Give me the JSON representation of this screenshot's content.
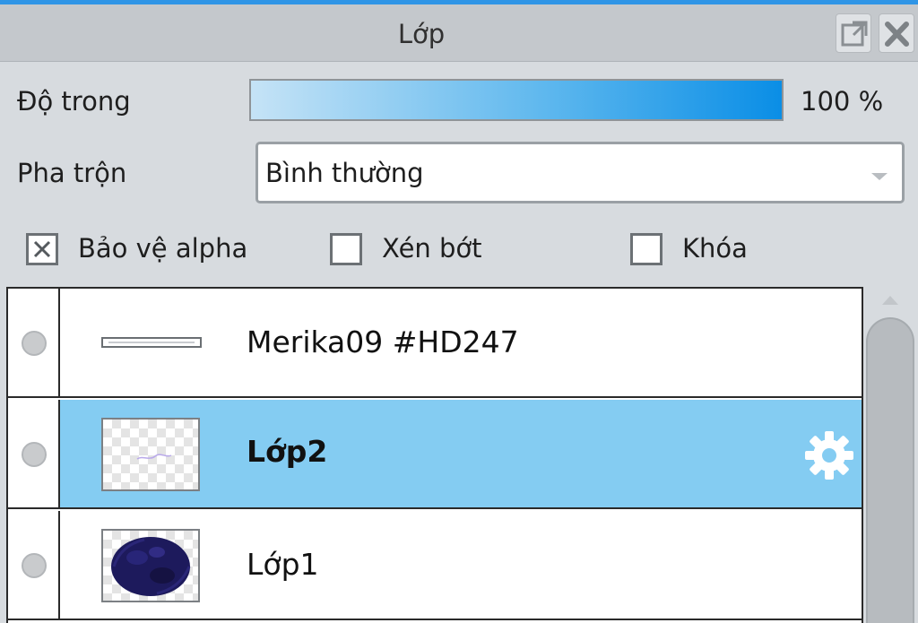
{
  "panel": {
    "title": "Lớp",
    "controls": {
      "undock_icon": "undock-icon",
      "close_icon": "close-icon"
    }
  },
  "opacity": {
    "label": "Độ trong",
    "value": 100,
    "value_text": "100 %"
  },
  "blend": {
    "label": "Pha trộn",
    "selected": "Bình thường"
  },
  "options": [
    {
      "label": "Bảo vệ alpha",
      "checked": true
    },
    {
      "label": "Xén bớt",
      "checked": false
    },
    {
      "label": "Khóa",
      "checked": false
    }
  ],
  "layers": [
    {
      "name": "Merika09 #HD247",
      "selected": false,
      "bold": false,
      "thumbnail": "border-thumbnail"
    },
    {
      "name": "Lớp2",
      "selected": true,
      "bold": true,
      "thumbnail": "transparent-thumbnail",
      "settings_icon": "gear-icon"
    },
    {
      "name": "Lớp1",
      "selected": false,
      "bold": false,
      "thumbnail": "scribble-thumbnail"
    }
  ],
  "colors": {
    "accent": "#2f95e6",
    "selected_row": "#84ccf2",
    "panel_bg": "#d7dbdf",
    "opacity_fill": "#0a8ee6",
    "scribble": "#1d1a5c"
  }
}
